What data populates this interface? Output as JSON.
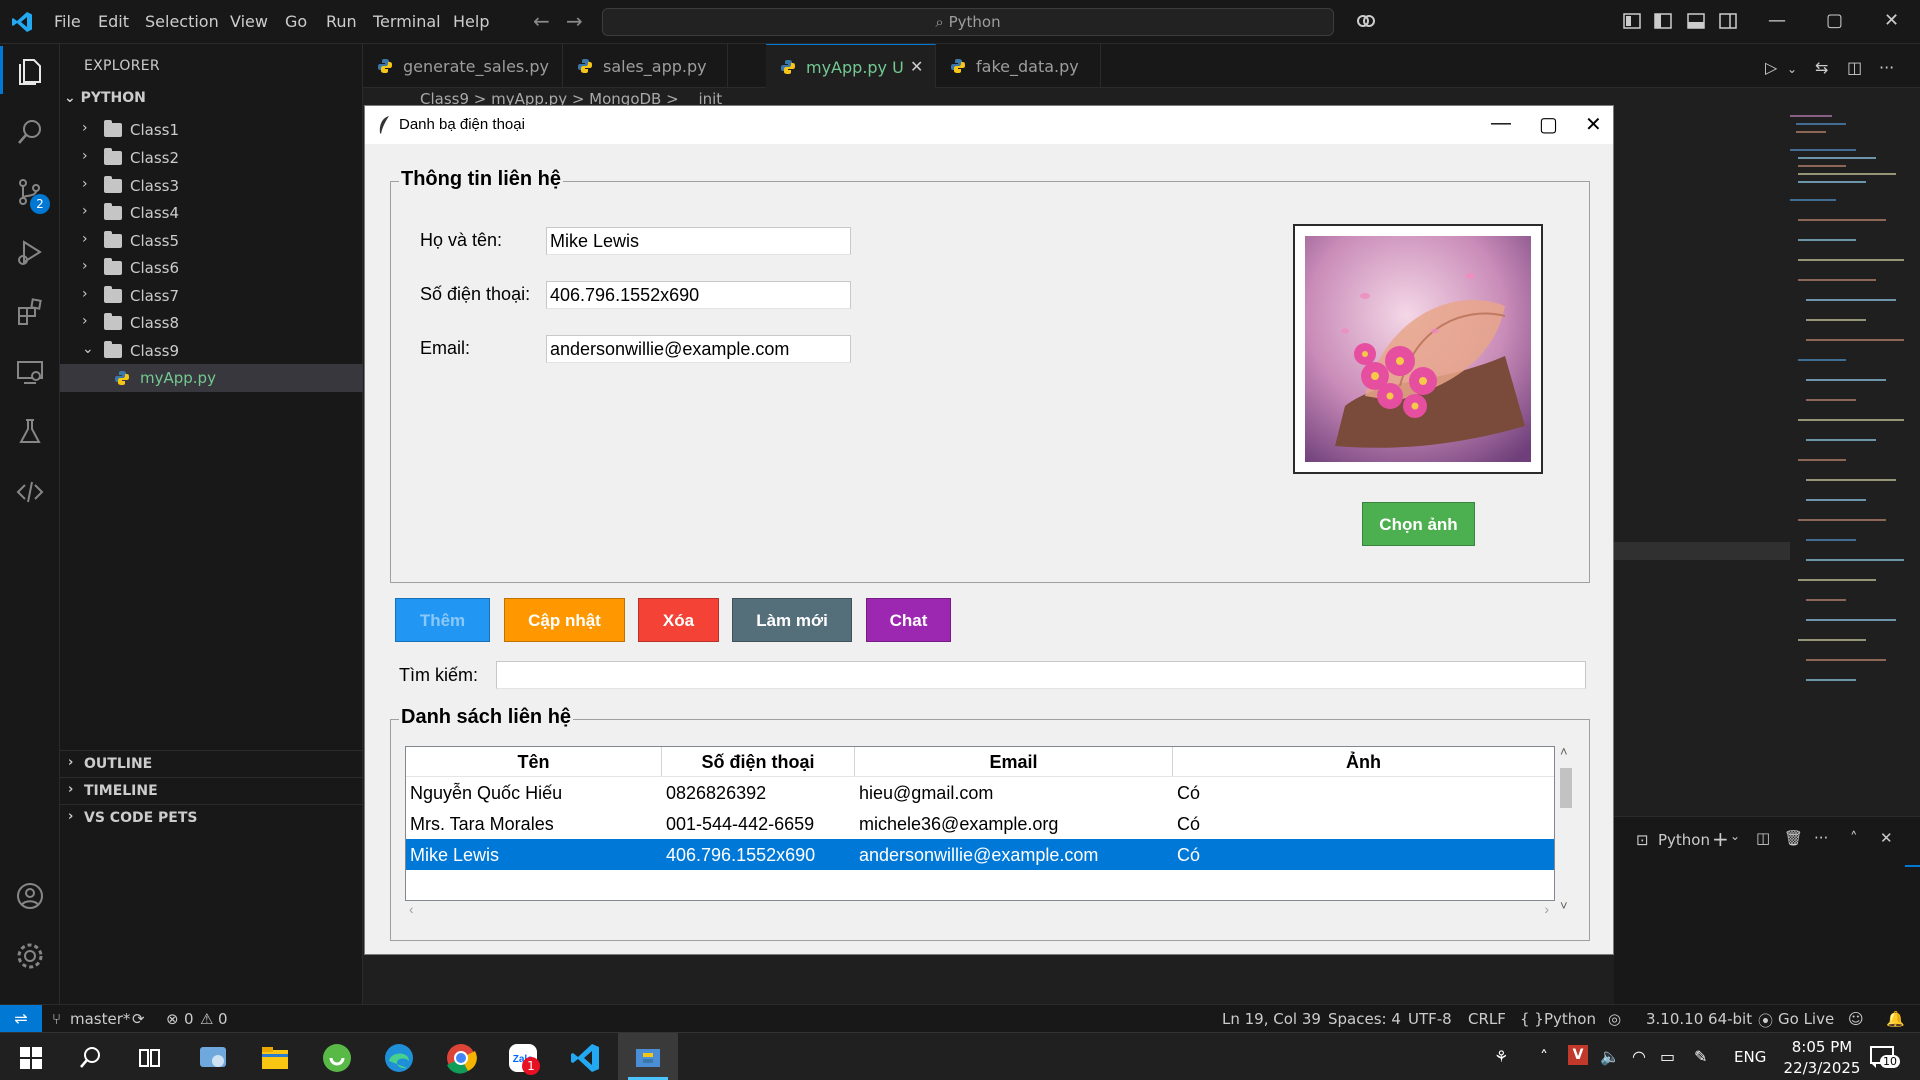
{
  "titlebar": {
    "menus": [
      "File",
      "Edit",
      "Selection",
      "View",
      "Go",
      "Run",
      "Terminal",
      "Help"
    ],
    "search_text": "Python"
  },
  "sidebar": {
    "title": "EXPLORER",
    "folder": "PYTHON",
    "items": [
      {
        "label": "Class1"
      },
      {
        "label": "Class2"
      },
      {
        "label": "Class3"
      },
      {
        "label": "Class4"
      },
      {
        "label": "Class5"
      },
      {
        "label": "Class6"
      },
      {
        "label": "Class7"
      },
      {
        "label": "Class8"
      },
      {
        "label": "Class9"
      }
    ],
    "file": "myApp.py",
    "sections": [
      "OUTLINE",
      "TIMELINE",
      "VS CODE PETS"
    ],
    "scm_badge": "2"
  },
  "tabs": [
    {
      "label": "generate_sales.py"
    },
    {
      "label": "sales_app.py"
    },
    {
      "label": "myApp.py U"
    },
    {
      "label": "fake_data.py"
    }
  ],
  "breadcrumb": "Class9 > myApp.py > MongoDB > __init__",
  "panel": {
    "terminal_label": "Python"
  },
  "statusbar": {
    "branch": "master*",
    "errors": "0",
    "warnings": "0",
    "position": "Ln 19, Col 39",
    "spaces": "Spaces: 4",
    "encoding": "UTF-8",
    "eol": "CRLF",
    "language": "Python",
    "interpreter": "3.10.10 64-bit",
    "golive": "Go Live"
  },
  "taskbar": {
    "lang": "ENG",
    "time": "8:05 PM",
    "date": "22/3/2025",
    "notif_count": "10",
    "zalo_badge": "1"
  },
  "app": {
    "title": "Danh bạ điện thoại",
    "info_group": "Thông tin liên hệ",
    "name_label": "Họ và tên:",
    "name_value": "Mike Lewis",
    "phone_label": "Số điện thoại:",
    "phone_value": "406.796.1552x690",
    "email_label": "Email:",
    "email_value": "andersonwillie@example.com",
    "choose_photo": "Chọn ảnh",
    "buttons": {
      "add": "Thêm",
      "update": "Cập nhật",
      "delete": "Xóa",
      "refresh": "Làm mới",
      "chat": "Chat"
    },
    "search_label": "Tìm kiếm:",
    "search_value": "",
    "list_group": "Danh sách liên hệ",
    "columns": [
      "Tên",
      "Số điện thoại",
      "Email",
      "Ảnh"
    ],
    "rows": [
      {
        "name": "Nguyễn Quốc Hiếu",
        "phone": "0826826392",
        "email": "hieu@gmail.com",
        "photo": "Có"
      },
      {
        "name": "Mrs. Tara Morales",
        "phone": "001-544-442-6659",
        "email": "michele36@example.org",
        "photo": "Có"
      },
      {
        "name": "Mike Lewis",
        "phone": "406.796.1552x690",
        "email": "andersonwillie@example.com",
        "photo": "Có"
      }
    ],
    "colors": {
      "add": "#2196f3",
      "update": "#ff9800",
      "delete": "#f44336",
      "refresh": "#546e7a",
      "chat": "#9c27b0",
      "choose_photo": "#4caf50",
      "selection": "#0078d7"
    }
  }
}
